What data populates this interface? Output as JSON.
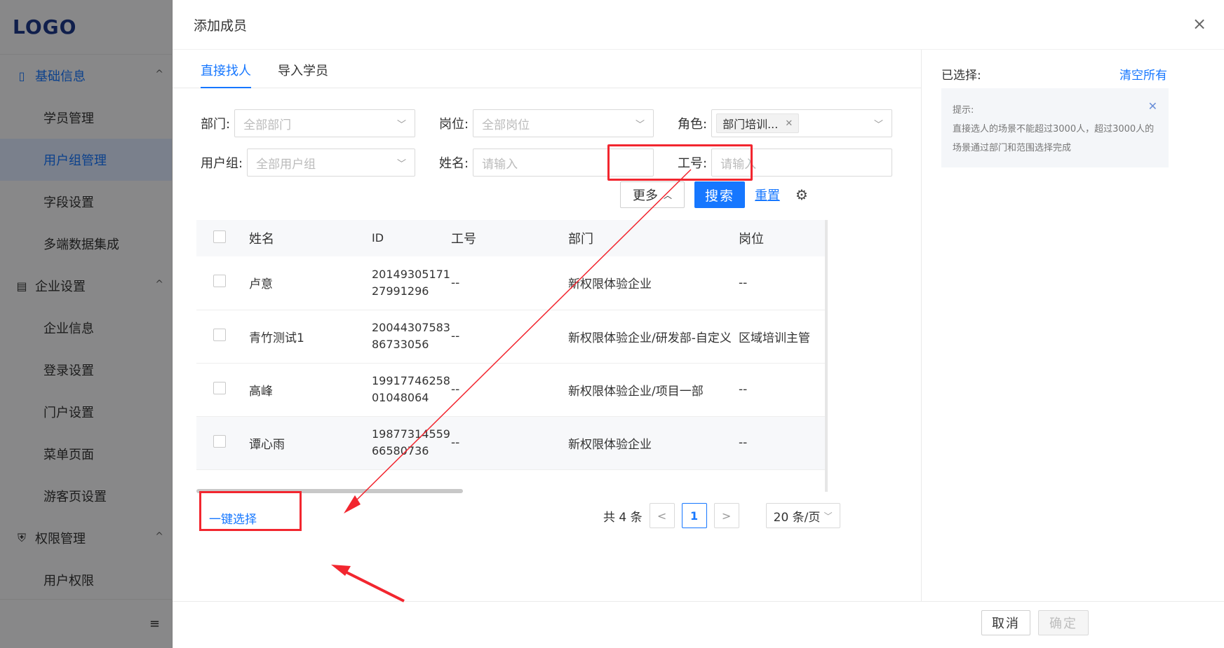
{
  "app": {
    "logo": "LOGO"
  },
  "sidebar": {
    "groups": [
      {
        "label": "基础信息",
        "icon": "book-icon",
        "items": [
          "学员管理",
          "用户组管理",
          "字段设置",
          "多端数据集成"
        ]
      },
      {
        "label": "企业设置",
        "icon": "building-icon",
        "items": [
          "企业信息",
          "登录设置",
          "门户设置",
          "菜单页面",
          "游客页设置"
        ]
      },
      {
        "label": "权限管理",
        "icon": "shield-icon",
        "items": [
          "用户权限"
        ]
      }
    ],
    "active_item": "用户组管理",
    "collapse_icon": "≡"
  },
  "dialog": {
    "title": "添加成员",
    "close_symbol": "×",
    "tabs": [
      "直接找人",
      "导入学员"
    ],
    "filters": {
      "dept_label": "部门:",
      "dept_placeholder": "全部部门",
      "post_label": "岗位:",
      "post_placeholder": "全部岗位",
      "role_label": "角色:",
      "role_tag": "部门培训...",
      "group_label": "用户组:",
      "group_placeholder": "全部用户组",
      "name_label": "姓名:",
      "name_placeholder": "请输入",
      "jobno_label": "工号:",
      "jobno_placeholder": "请输入"
    },
    "actions": {
      "more": "更多",
      "search": "搜索",
      "reset": "重置"
    },
    "table": {
      "columns": [
        "姓名",
        "ID",
        "工号",
        "部门",
        "岗位"
      ],
      "rows": [
        {
          "name": "卢意",
          "id1": "20149305171",
          "id2": "27991296",
          "jobno": "--",
          "dept": "新权限体验企业",
          "post": "--"
        },
        {
          "name": "青竹测试1",
          "id1": "20044307583",
          "id2": "86733056",
          "jobno": "--",
          "dept": "新权限体验企业/研发部-自定义",
          "post": "区域培训主管"
        },
        {
          "name": "高峰",
          "id1": "19917746258",
          "id2": "01048064",
          "jobno": "--",
          "dept": "新权限体验企业/项目一部",
          "post": "--"
        },
        {
          "name": "谭心雨",
          "id1": "19877314559",
          "id2": "66580736",
          "jobno": "--",
          "dept": "新权限体验企业",
          "post": "--"
        }
      ]
    },
    "bulk_select": "一键选择",
    "pagination": {
      "total": "共 4 条",
      "prev": "<",
      "current": "1",
      "next": ">",
      "page_size": "20 条/页"
    },
    "selected": {
      "title": "已选择:",
      "clear_all": "清空所有",
      "tip_title": "提示:",
      "tip_line1": "直接选人的场景不能超过3000人，超过3000人的",
      "tip_line2": "场景通过部门和范围选择完成"
    },
    "footer": {
      "cancel": "取消",
      "confirm": "确定"
    }
  },
  "colors": {
    "primary": "#1677ff",
    "annotation_red": "#f2262f"
  }
}
